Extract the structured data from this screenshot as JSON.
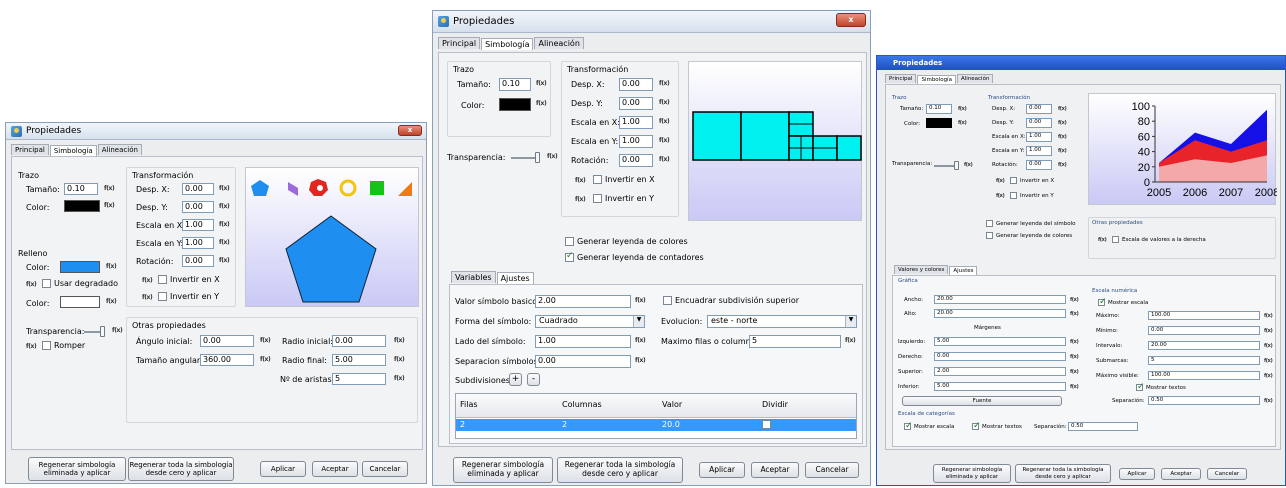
{
  "w1": {
    "title": "Propiedades",
    "close": "x",
    "tabs": [
      "Principal",
      "Simbología",
      "Alineación"
    ],
    "trazo": "Trazo",
    "tamano_lbl": "Tamaño:",
    "tamano": "0.10",
    "color_lbl": "Color:",
    "transf": "Transformación",
    "desp_x_lbl": "Desp. X:",
    "desp_x": "0.00",
    "desp_y_lbl": "Desp. Y:",
    "desp_y": "0.00",
    "esc_x_lbl": "Escala en X:",
    "esc_x": "1.00",
    "esc_y_lbl": "Escala en Y:",
    "esc_y": "1.00",
    "rot_lbl": "Rotación:",
    "rot": "0.00",
    "inv_x": "Invertir en X",
    "inv_y": "Invertir en Y",
    "relleno": "Relleno",
    "color1_lbl": "Color:",
    "degradado": "Usar degradado",
    "color2_lbl": "Color:",
    "transp": "Transparencia:",
    "romper": "Romper",
    "otras": "Otras propiedades",
    "ang_ini_lbl": "Ángulo inicial:",
    "ang_ini": "0.00",
    "radio_ini_lbl": "Radio inicial:",
    "radio_ini": "0.00",
    "tam_ang_lbl": "Tamaño angular:",
    "tam_ang": "360.00",
    "radio_fin_lbl": "Radio final:",
    "radio_fin": "5.00",
    "aristas_lbl": "Nº de aristas:",
    "aristas": "5",
    "fx": "f(x)",
    "buttons": [
      "Regenerar simbología eliminada y aplicar",
      "Regenerar toda la simbología desde cero y aplicar",
      "Aplicar",
      "Aceptar",
      "Cancelar"
    ],
    "colors": {
      "fill": "#1e8ff0",
      "shape_palette": [
        "#1e8ff0",
        "#9b6bdc",
        "#e0261f",
        "#f2c40c",
        "#15c21a",
        "#f07a12"
      ]
    }
  },
  "w2": {
    "title": "Propiedades",
    "close": "x",
    "tabs": [
      "Principal",
      "Simbología",
      "Alineación"
    ],
    "trazo": "Trazo",
    "tamano_lbl": "Tamaño:",
    "tamano": "0.10",
    "color_lbl": "Color:",
    "transf": "Transformación",
    "desp_x_lbl": "Desp. X:",
    "desp_x": "0.00",
    "desp_y_lbl": "Desp. Y:",
    "desp_y": "0.00",
    "esc_x_lbl": "Escala en X:",
    "esc_x": "1.00",
    "esc_y_lbl": "Escala en Y:",
    "esc_y": "1.00",
    "rot_lbl": "Rotación:",
    "rot": "0.00",
    "inv_x": "Invertir en X",
    "inv_y": "Invertir en Y",
    "transp": "Transparencia:",
    "leyenda_colores": "Generar leyenda de colores",
    "leyenda_contadores": "Generar leyenda de contadores",
    "subtabs": [
      "Variables",
      "Ajustes"
    ],
    "valor_lbl": "Valor símbolo basico:",
    "valor": "2.00",
    "encuadrar": "Encuadrar subdivisión superior",
    "forma_lbl": "Forma del símbolo:",
    "forma": "Cuadrado",
    "evol_lbl": "Evolucion:",
    "evol": "este - norte",
    "lado_lbl": "Lado del símbolo:",
    "lado": "1.00",
    "max_lbl": "Maximo filas o columnas:",
    "max": "5",
    "sep_lbl": "Separacion símbolos:",
    "sep": "0.00",
    "subdiv": "Subdivisiones:",
    "plus": "+",
    "minus": "-",
    "table_head": [
      "Filas",
      "Columnas",
      "Valor",
      "Dividir"
    ],
    "table_row": [
      "2",
      "2",
      "20.0",
      ""
    ],
    "fx": "f(x)",
    "buttons": [
      "Regenerar simbología eliminada y aplicar",
      "Regenerar toda la simbología desde cero y aplicar",
      "Aplicar",
      "Aceptar",
      "Cancelar"
    ],
    "colors": {
      "symbol": "#00f0f0",
      "selection": "#3399ff"
    }
  },
  "w3": {
    "title": "Propiedades",
    "tabs": [
      "Principal",
      "Simbología",
      "Alineación"
    ],
    "trazo": "Trazo",
    "tamano_lbl": "Tamaño:",
    "tamano": "0.10",
    "color_lbl": "Color:",
    "transf": "Transformación",
    "desp_x_lbl": "Desp. X:",
    "desp_x": "0.00",
    "desp_y_lbl": "Desp. Y:",
    "desp_y": "0.00",
    "esc_x_lbl": "Escala en X:",
    "esc_x": "1.00",
    "esc_y_lbl": "Escala en Y:",
    "esc_y": "1.00",
    "rot_lbl": "Rotación:",
    "rot": "0.00",
    "inv_x": "Invertir en X",
    "inv_y": "Invertir en Y",
    "transp": "Transparencia:",
    "leyenda_simbolo": "Generar leyenda del símbolo",
    "leyenda_colores": "Generar leyenda de colores",
    "otras": "Otras propiedades",
    "escala_derecha": "Escala de valores a la derecha",
    "subtabs": [
      "Valores y colores",
      "Ajustes"
    ],
    "grafica": "Gráfica",
    "ancho_lbl": "Ancho:",
    "ancho": "20.00",
    "alto_lbl": "Alto:",
    "alto": "20.00",
    "margenes": "Márgenes",
    "izq_lbl": "Izquierdo:",
    "izq": "5.00",
    "der_lbl": "Derecho:",
    "der": "0.00",
    "sup_lbl": "Superior:",
    "sup": "2.00",
    "inf_lbl": "Inferior:",
    "inf": "5.00",
    "fuente": "Fuente",
    "esc_num": "Escala numérica",
    "mostrar_escala": "Mostrar escala",
    "max_lbl": "Máximo:",
    "max": "100.00",
    "min_lbl": "Mínimo:",
    "min": "0.00",
    "int_lbl": "Intervalo:",
    "int": "20.00",
    "submarcas_lbl": "Submarcas:",
    "submarcas": "5",
    "maxvis_lbl": "Máximo visible:",
    "maxvis": "100.00",
    "mostrar_textos": "Mostrar textos",
    "separacion_lbl": "Separación:",
    "separacion": "0.50",
    "esc_cat": "Escala de categorías",
    "cat_mostrar_escala": "Mostrar escala",
    "cat_mostrar_textos": "Mostrar textos",
    "cat_sep_lbl": "Separación:",
    "cat_sep": "0.50",
    "fx": "f(x)",
    "buttons": [
      "Regenerar simbología eliminada y aplicar",
      "Regenerar toda la simbología desde cero y aplicar",
      "Aplicar",
      "Aceptar",
      "Cancelar"
    ]
  },
  "chart_data": {
    "type": "area",
    "categories": [
      "2005",
      "2006",
      "2007",
      "2008"
    ],
    "y_ticks": [
      "0",
      "20",
      "40",
      "60",
      "80",
      "100"
    ],
    "ylim": [
      0,
      100
    ],
    "series": [
      {
        "values": [
          20,
          30,
          25,
          35
        ],
        "color": "#f4a9a8"
      },
      {
        "values": [
          25,
          55,
          40,
          55
        ],
        "color": "#e8242a"
      },
      {
        "values": [
          25,
          65,
          50,
          95
        ],
        "color": "#1410e6"
      }
    ]
  }
}
